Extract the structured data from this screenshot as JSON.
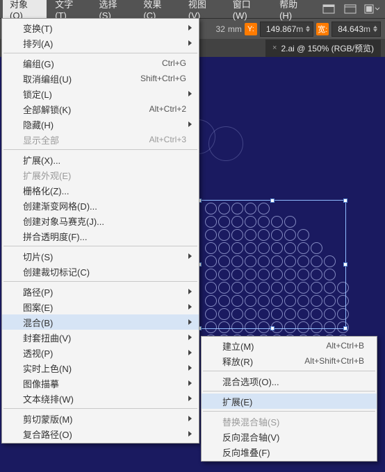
{
  "menubar": {
    "items": [
      "对象(O)",
      "文字(T)",
      "选择(S)",
      "效果(C)",
      "视图(V)",
      "窗口(W)",
      "帮助(H)"
    ]
  },
  "ctrlbar": {
    "x_value": "32",
    "x_unit": "mm",
    "y_label": "Y:",
    "y_value": "149.867",
    "y_unit": "m",
    "w_label": "宽:",
    "w_value": "84.643",
    "w_unit": "m"
  },
  "tab": {
    "close": "×",
    "label": "2.ai @ 150% (RGB/预览)"
  },
  "menu_main": {
    "items": [
      {
        "label": "变换(T)",
        "shortcut": "",
        "sub": true
      },
      {
        "label": "排列(A)",
        "shortcut": "",
        "sub": true
      },
      {
        "sep": true
      },
      {
        "label": "编组(G)",
        "shortcut": "Ctrl+G"
      },
      {
        "label": "取消编组(U)",
        "shortcut": "Shift+Ctrl+G"
      },
      {
        "label": "锁定(L)",
        "shortcut": "",
        "sub": true
      },
      {
        "label": "全部解锁(K)",
        "shortcut": "Alt+Ctrl+2"
      },
      {
        "label": "隐藏(H)",
        "shortcut": "",
        "sub": true
      },
      {
        "label": "显示全部",
        "shortcut": "Alt+Ctrl+3",
        "disabled": true
      },
      {
        "sep": true
      },
      {
        "label": "扩展(X)...",
        "shortcut": ""
      },
      {
        "label": "扩展外观(E)",
        "shortcut": "",
        "disabled": true
      },
      {
        "label": "栅格化(Z)...",
        "shortcut": ""
      },
      {
        "label": "创建渐变网格(D)...",
        "shortcut": ""
      },
      {
        "label": "创建对象马赛克(J)...",
        "shortcut": ""
      },
      {
        "label": "拼合透明度(F)...",
        "shortcut": ""
      },
      {
        "sep": true
      },
      {
        "label": "切片(S)",
        "shortcut": "",
        "sub": true
      },
      {
        "label": "创建裁切标记(C)",
        "shortcut": ""
      },
      {
        "sep": true
      },
      {
        "label": "路径(P)",
        "shortcut": "",
        "sub": true
      },
      {
        "label": "图案(E)",
        "shortcut": "",
        "sub": true
      },
      {
        "label": "混合(B)",
        "shortcut": "",
        "sub": true,
        "highlight": true
      },
      {
        "label": "封套扭曲(V)",
        "shortcut": "",
        "sub": true
      },
      {
        "label": "透视(P)",
        "shortcut": "",
        "sub": true
      },
      {
        "label": "实时上色(N)",
        "shortcut": "",
        "sub": true
      },
      {
        "label": "图像描摹",
        "shortcut": "",
        "sub": true
      },
      {
        "label": "文本绕排(W)",
        "shortcut": "",
        "sub": true
      },
      {
        "sep": true
      },
      {
        "label": "剪切蒙版(M)",
        "shortcut": "",
        "sub": true
      },
      {
        "label": "复合路径(O)",
        "shortcut": "",
        "sub": true
      }
    ]
  },
  "menu_sub": {
    "items": [
      {
        "label": "建立(M)",
        "shortcut": "Alt+Ctrl+B"
      },
      {
        "label": "释放(R)",
        "shortcut": "Alt+Shift+Ctrl+B"
      },
      {
        "sep": true
      },
      {
        "label": "混合选项(O)...",
        "shortcut": ""
      },
      {
        "sep": true
      },
      {
        "label": "扩展(E)",
        "shortcut": "",
        "highlight": true
      },
      {
        "sep": true
      },
      {
        "label": "替换混合轴(S)",
        "shortcut": "",
        "disabled": true
      },
      {
        "label": "反向混合轴(V)",
        "shortcut": ""
      },
      {
        "label": "反向堆叠(F)",
        "shortcut": ""
      }
    ]
  }
}
